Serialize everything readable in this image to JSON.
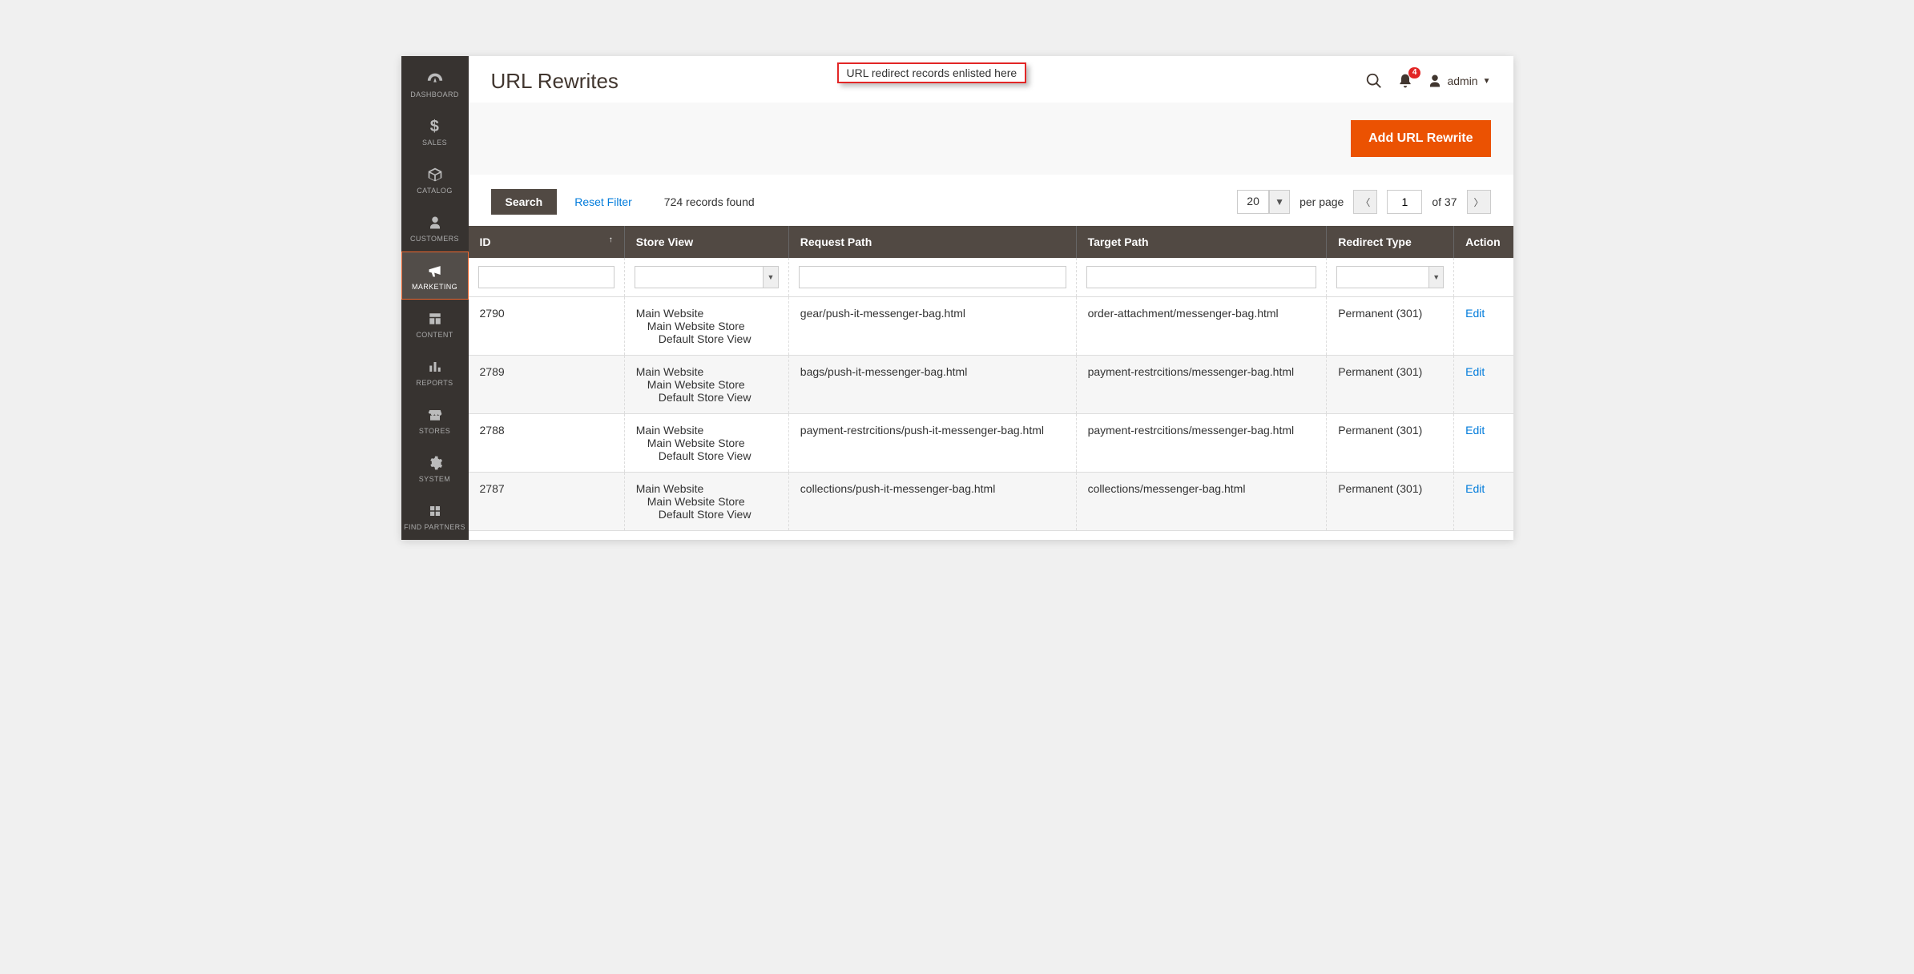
{
  "sidebar": {
    "items": [
      {
        "label": "DASHBOARD",
        "icon": "gauge"
      },
      {
        "label": "SALES",
        "icon": "dollar"
      },
      {
        "label": "CATALOG",
        "icon": "box"
      },
      {
        "label": "CUSTOMERS",
        "icon": "person"
      },
      {
        "label": "MARKETING",
        "icon": "megaphone"
      },
      {
        "label": "CONTENT",
        "icon": "layout"
      },
      {
        "label": "REPORTS",
        "icon": "bars"
      },
      {
        "label": "STORES",
        "icon": "storefront"
      },
      {
        "label": "SYSTEM",
        "icon": "gear"
      },
      {
        "label": "FIND PARTNERS",
        "icon": "blocks"
      }
    ],
    "active_index": 4
  },
  "page": {
    "title": "URL Rewrites",
    "callout": "URL redirect records enlisted here",
    "notification_count": "4",
    "user_label": "admin"
  },
  "actions": {
    "add_label": "Add URL Rewrite"
  },
  "toolbar": {
    "search_label": "Search",
    "reset_label": "Reset Filter",
    "records_found": "724 records found",
    "per_page_value": "20",
    "per_page_text": "per page",
    "current_page": "1",
    "of_text": "of 37"
  },
  "columns": {
    "id": "ID",
    "store_view": "Store View",
    "request_path": "Request Path",
    "target_path": "Target Path",
    "redirect_type": "Redirect Type",
    "action": "Action"
  },
  "store_view_lines": {
    "l1": "Main Website",
    "l2": "Main Website Store",
    "l3": "Default Store View"
  },
  "edit_label": "Edit",
  "rows": [
    {
      "id": "2790",
      "request": "gear/push-it-messenger-bag.html",
      "target": "order-attachment/messenger-bag.html",
      "redirect": "Permanent (301)"
    },
    {
      "id": "2789",
      "request": "bags/push-it-messenger-bag.html",
      "target": "payment-restrcitions/messenger-bag.html",
      "redirect": "Permanent (301)"
    },
    {
      "id": "2788",
      "request": "payment-restrcitions/push-it-messenger-bag.html",
      "target": "payment-restrcitions/messenger-bag.html",
      "redirect": "Permanent (301)"
    },
    {
      "id": "2787",
      "request": "collections/push-it-messenger-bag.html",
      "target": "collections/messenger-bag.html",
      "redirect": "Permanent (301)"
    }
  ]
}
